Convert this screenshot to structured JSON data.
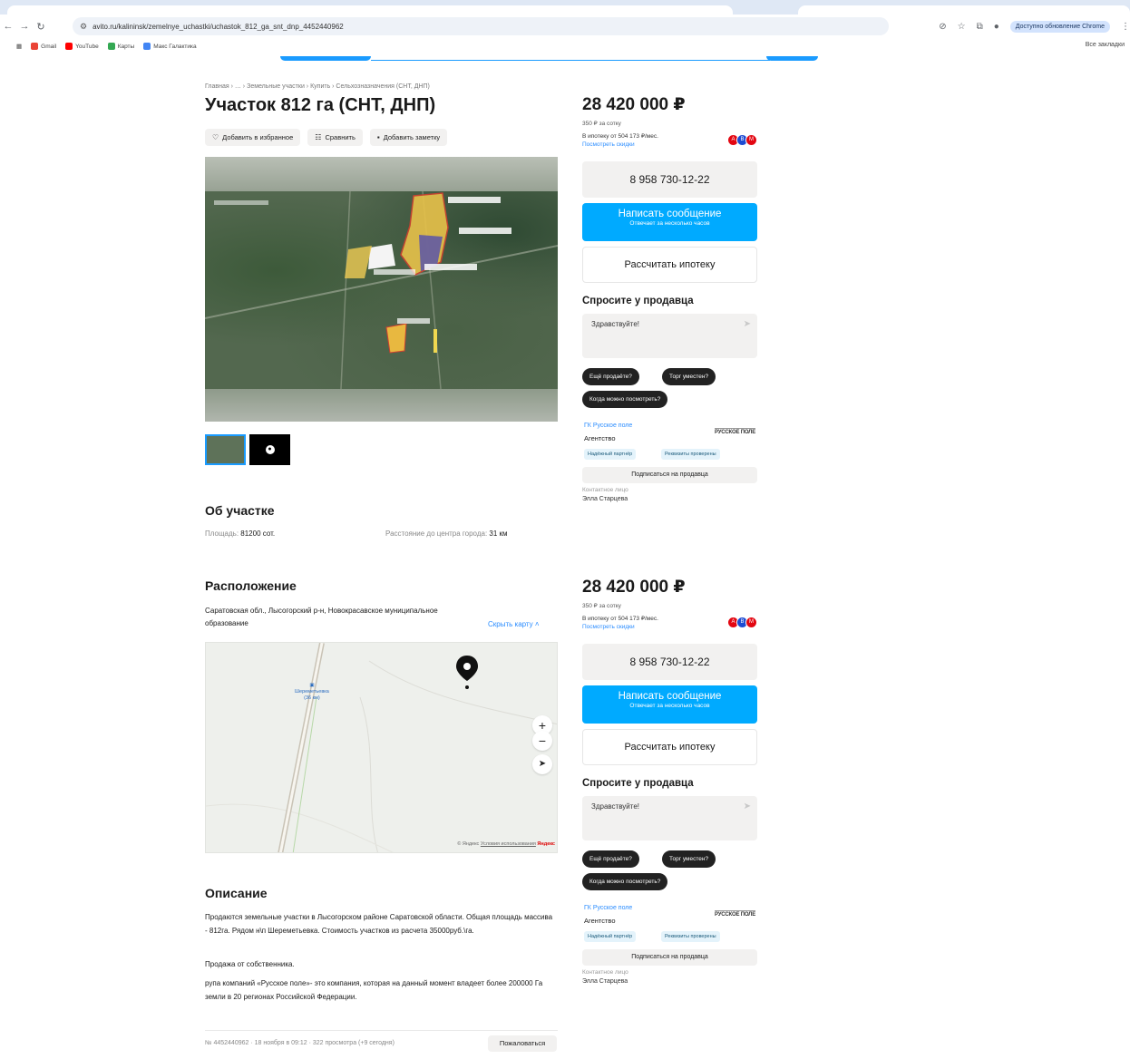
{
  "browser": {
    "url": "avito.ru/kalininsk/zemelnye_uchastki/uchastok_812_ga_snt_dnp_4452440962",
    "update_label": "Доступно обновление Chrome",
    "bookmarks": [
      {
        "label": "Gmail",
        "color": "#ea4335"
      },
      {
        "label": "YouTube",
        "color": "#ff0000"
      },
      {
        "label": "Карты",
        "color": "#34a853"
      },
      {
        "label": "Макс Галактика",
        "color": "#4285f4"
      }
    ],
    "all_bookmarks": "Все закладки"
  },
  "listing": {
    "breadcrumb": "Главная › … › Земельные участки › Купить › Сельхозназначения (СНТ, ДНП)",
    "title": "Участок 812 га (СНТ, ДНП)",
    "actions": {
      "favorite": "Добавить в избранное",
      "compare": "Сравнить",
      "note": "Добавить заметку"
    },
    "about": {
      "heading": "Об участке",
      "area_label": "Площадь:",
      "area_value": "81200 сот.",
      "distance_label": "Расстояние до центра города:",
      "distance_value": "31 км"
    },
    "location": {
      "heading": "Расположение",
      "address": "Саратовская обл., Лысогорский р-н, Новокрасавское муниципальное образование",
      "hide_map": "Скрыть карту ˄",
      "map_village": "Шереметьевка",
      "map_village_dist": "(36 км)",
      "map_attr_prefix": "© Яндекс",
      "map_attr_terms": "Условия использования",
      "map_attr_brand": "Яндекс"
    },
    "description": {
      "heading": "Описание",
      "p1": "Продаются земельные участки в Лысогорском районе Саратовской области. Общая площадь массива - 812га. Рядом н\\п Шереметьевка. Стоимость участков из расчета 35000руб.\\га.",
      "p2": "Продажа от собственника.",
      "p3": "рупа компаний «Русское поле»- это компания, которая на данный момент владеет более 200000 Га земли в 20 регионах Российской Федерации."
    },
    "footer": {
      "meta": "№ 4452440962 · 18 ноября в 09:12 · 322 просмотра (+9 сегодня)",
      "complain": "Пожаловаться"
    }
  },
  "sidebar": {
    "price": "28 420 000 ₽",
    "per_unit": "350 ₽ за сотку",
    "mortgage": "В ипотеку от 504 173 ₽/мес.",
    "discounts": "Посмотреть скидки",
    "phone": "8 958 730-12-22",
    "message_title": "Написать сообщение",
    "message_sub": "Отвечает за несколько часов",
    "calc_mortgage": "Рассчитать ипотеку",
    "ask_heading": "Спросите у продавца",
    "ask_placeholder": "Здравствуйте!",
    "chips": [
      "Ещё продаёте?",
      "Торг уместен?",
      "Когда можно посмотреть?"
    ],
    "seller_name": "ГК Русское поле",
    "seller_type": "Агентство",
    "seller_logo": "РУССКОЕ ПОЛЕ",
    "badges": [
      "Надёжный партнёр",
      "Реквизиты проверены"
    ],
    "subscribe": "Подписаться на продавца",
    "contact_label": "Контактное лицо",
    "contact_name": "Элла Старцева",
    "bank_colors": [
      "#e30611",
      "#1e4bd2",
      "#e30611"
    ]
  }
}
